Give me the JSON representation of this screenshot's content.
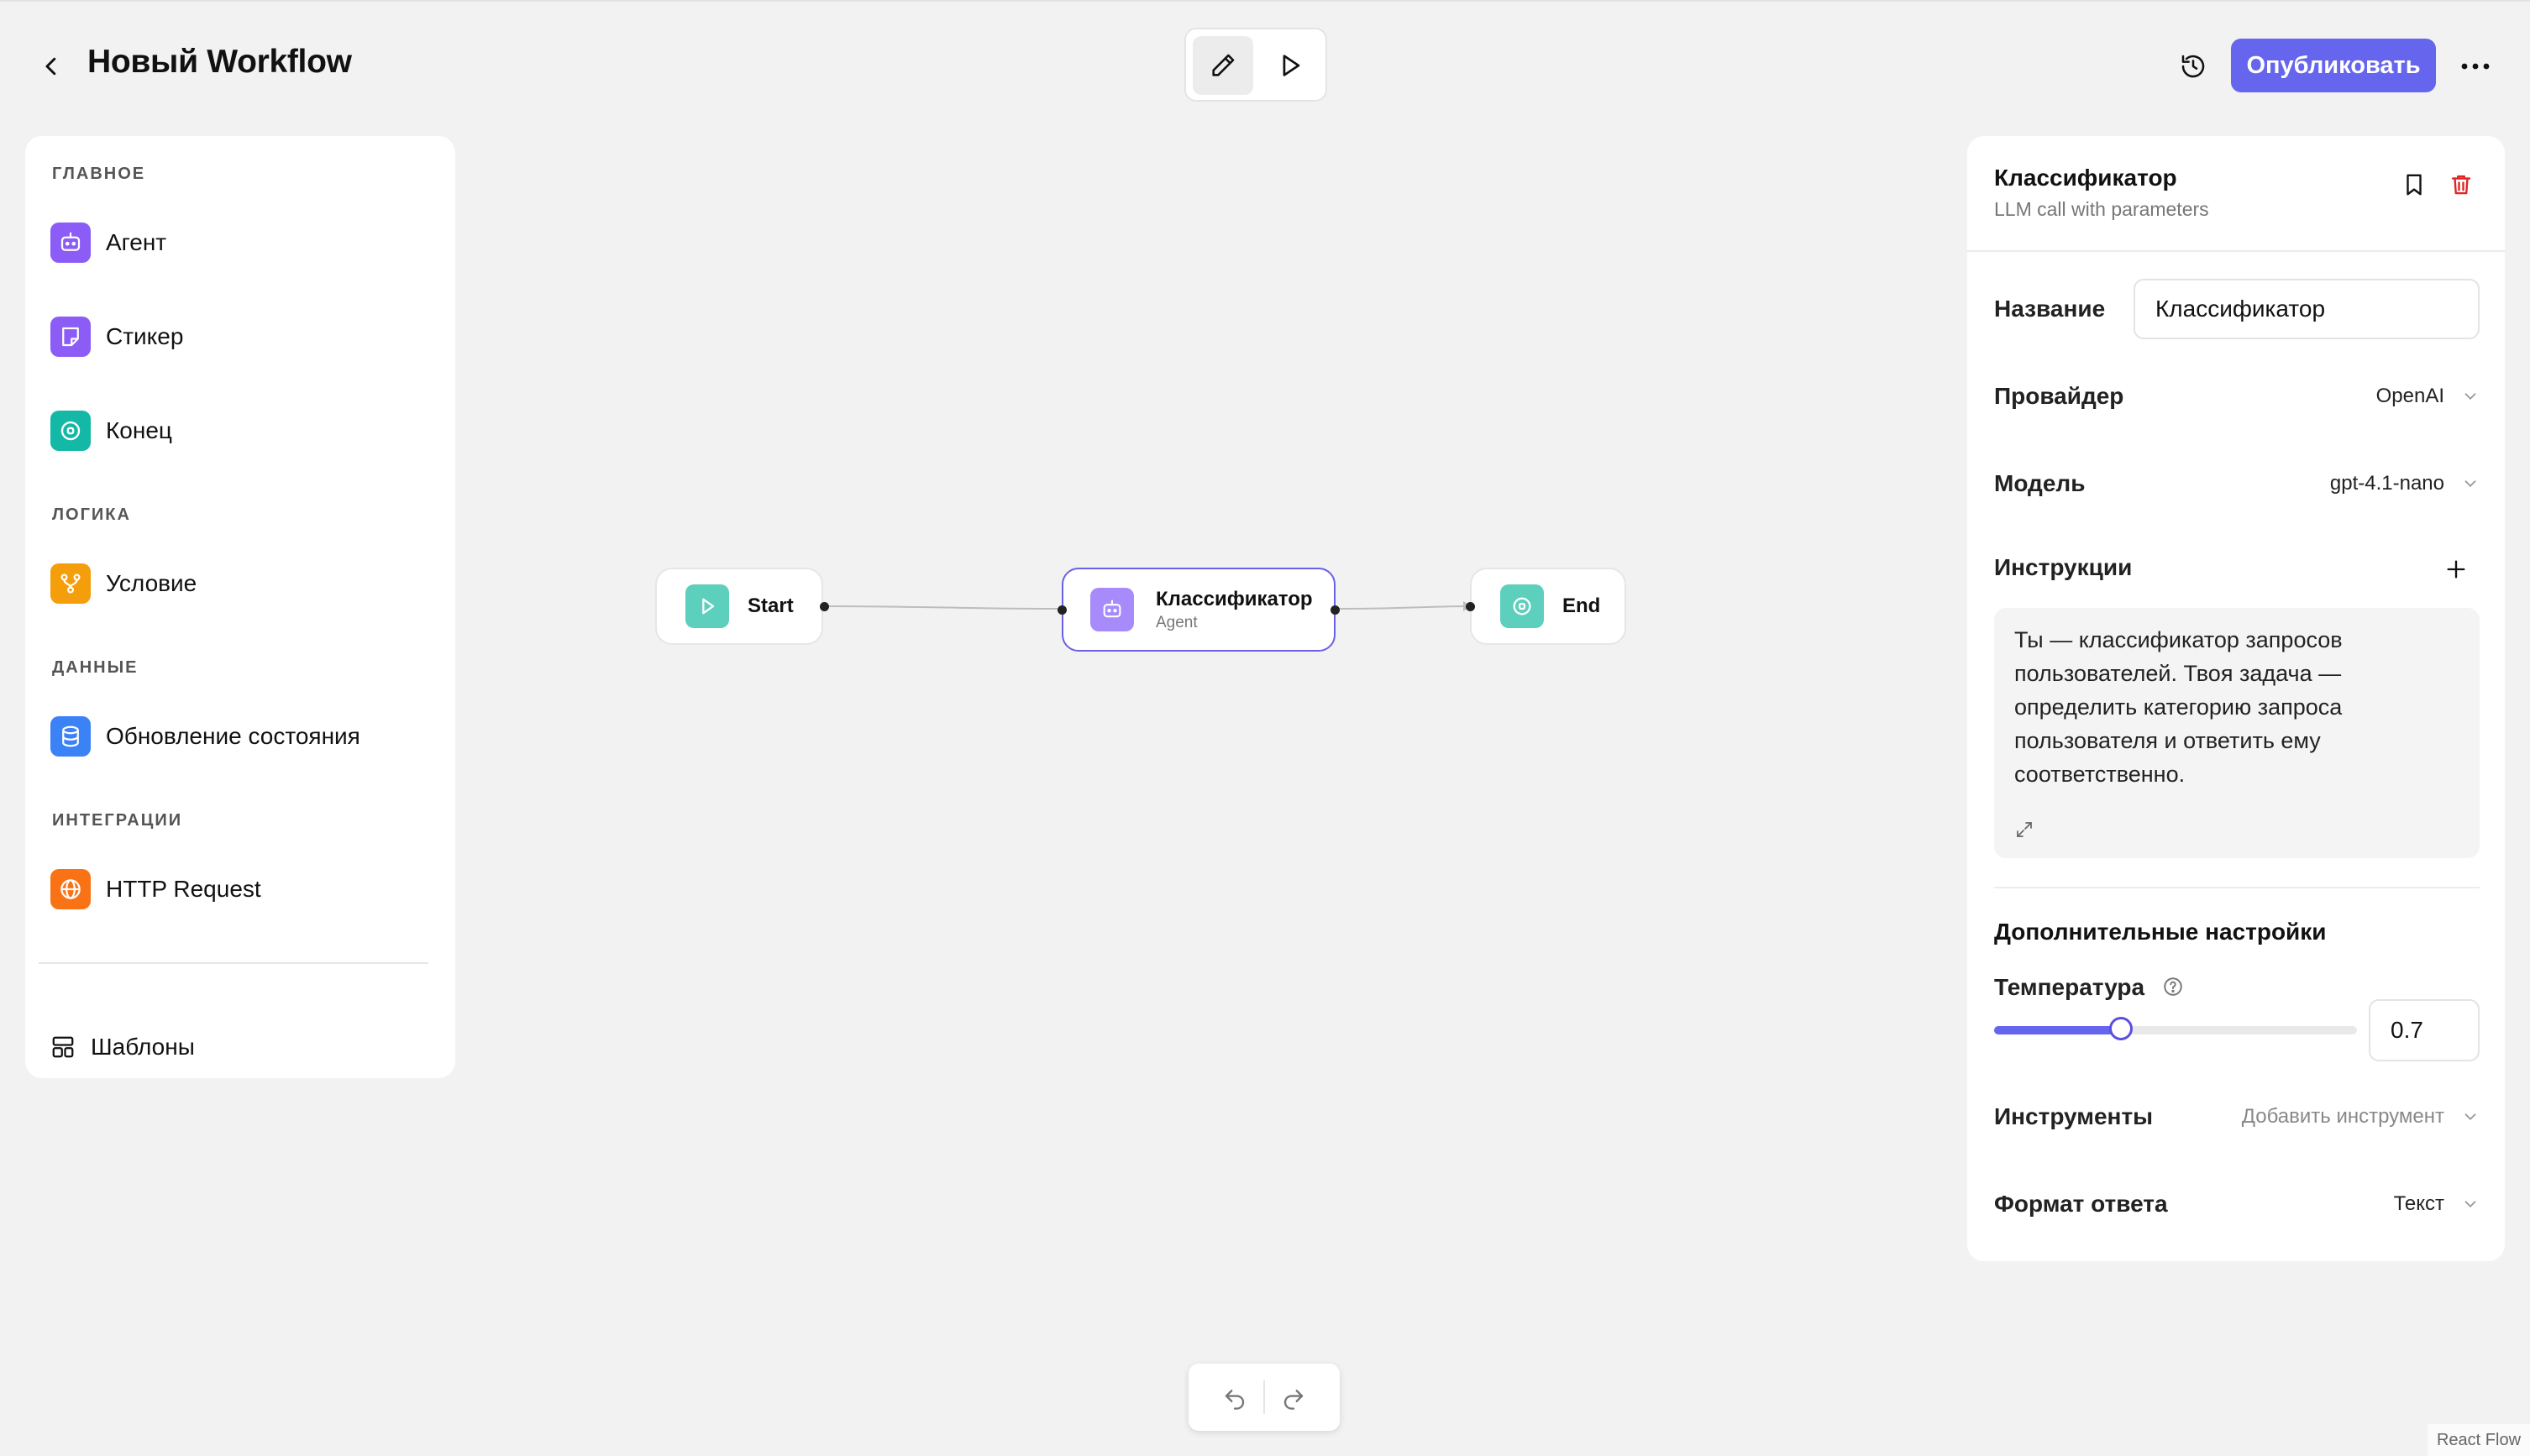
{
  "header": {
    "title": "Новый Workflow",
    "publish_label": "Опубликовать",
    "accent_color": "#6565ee"
  },
  "palette": {
    "sections": [
      {
        "label": "ГЛАВНОЕ",
        "items": [
          {
            "label": "Агент",
            "icon": "robot-icon",
            "color": "#8b5cf6"
          },
          {
            "label": "Стикер",
            "icon": "sticker-icon",
            "color": "#8b5cf6"
          },
          {
            "label": "Конец",
            "icon": "stop-circle-icon",
            "color": "#14b8a6"
          }
        ]
      },
      {
        "label": "ЛОГИКА",
        "items": [
          {
            "label": "Условие",
            "icon": "branch-icon",
            "color": "#f59e0b"
          }
        ]
      },
      {
        "label": "ДАННЫЕ",
        "items": [
          {
            "label": "Обновление состояния",
            "icon": "database-icon",
            "color": "#3b82f6"
          }
        ]
      },
      {
        "label": "ИНТЕГРАЦИИ",
        "items": [
          {
            "label": "HTTP Request",
            "icon": "globe-icon",
            "color": "#f97316"
          }
        ]
      }
    ],
    "templates_label": "Шаблоны"
  },
  "canvas": {
    "nodes": [
      {
        "title": "Start",
        "icon": "play-icon",
        "color": "#5ccfbd"
      },
      {
        "title": "Классификатор",
        "subtitle": "Agent",
        "icon": "robot-icon",
        "color": "#a78bfa"
      },
      {
        "title": "End",
        "icon": "stop-circle-icon",
        "color": "#5ccfbd"
      }
    ],
    "attribution": "React Flow"
  },
  "properties": {
    "title": "Классификатор",
    "subtitle": "LLM call with parameters",
    "name_label": "Название",
    "name_value": "Классификатор",
    "provider_label": "Провайдер",
    "provider_value": "OpenAI",
    "model_label": "Модель",
    "model_value": "gpt-4.1-nano",
    "instructions_label": "Инструкции",
    "instructions_text": "Ты — классификатор запросов пользователей. Твоя задача — определить категорию запроса пользователя и ответить ему соответственно.",
    "advanced_label": "Дополнительные настройки",
    "temperature_label": "Температура",
    "temperature_value": "0.7",
    "temperature_fraction": 0.35,
    "tools_label": "Инструменты",
    "tools_placeholder": "Добавить инструмент",
    "format_label": "Формат ответа",
    "format_value": "Текст",
    "delete_color": "#e02424"
  }
}
